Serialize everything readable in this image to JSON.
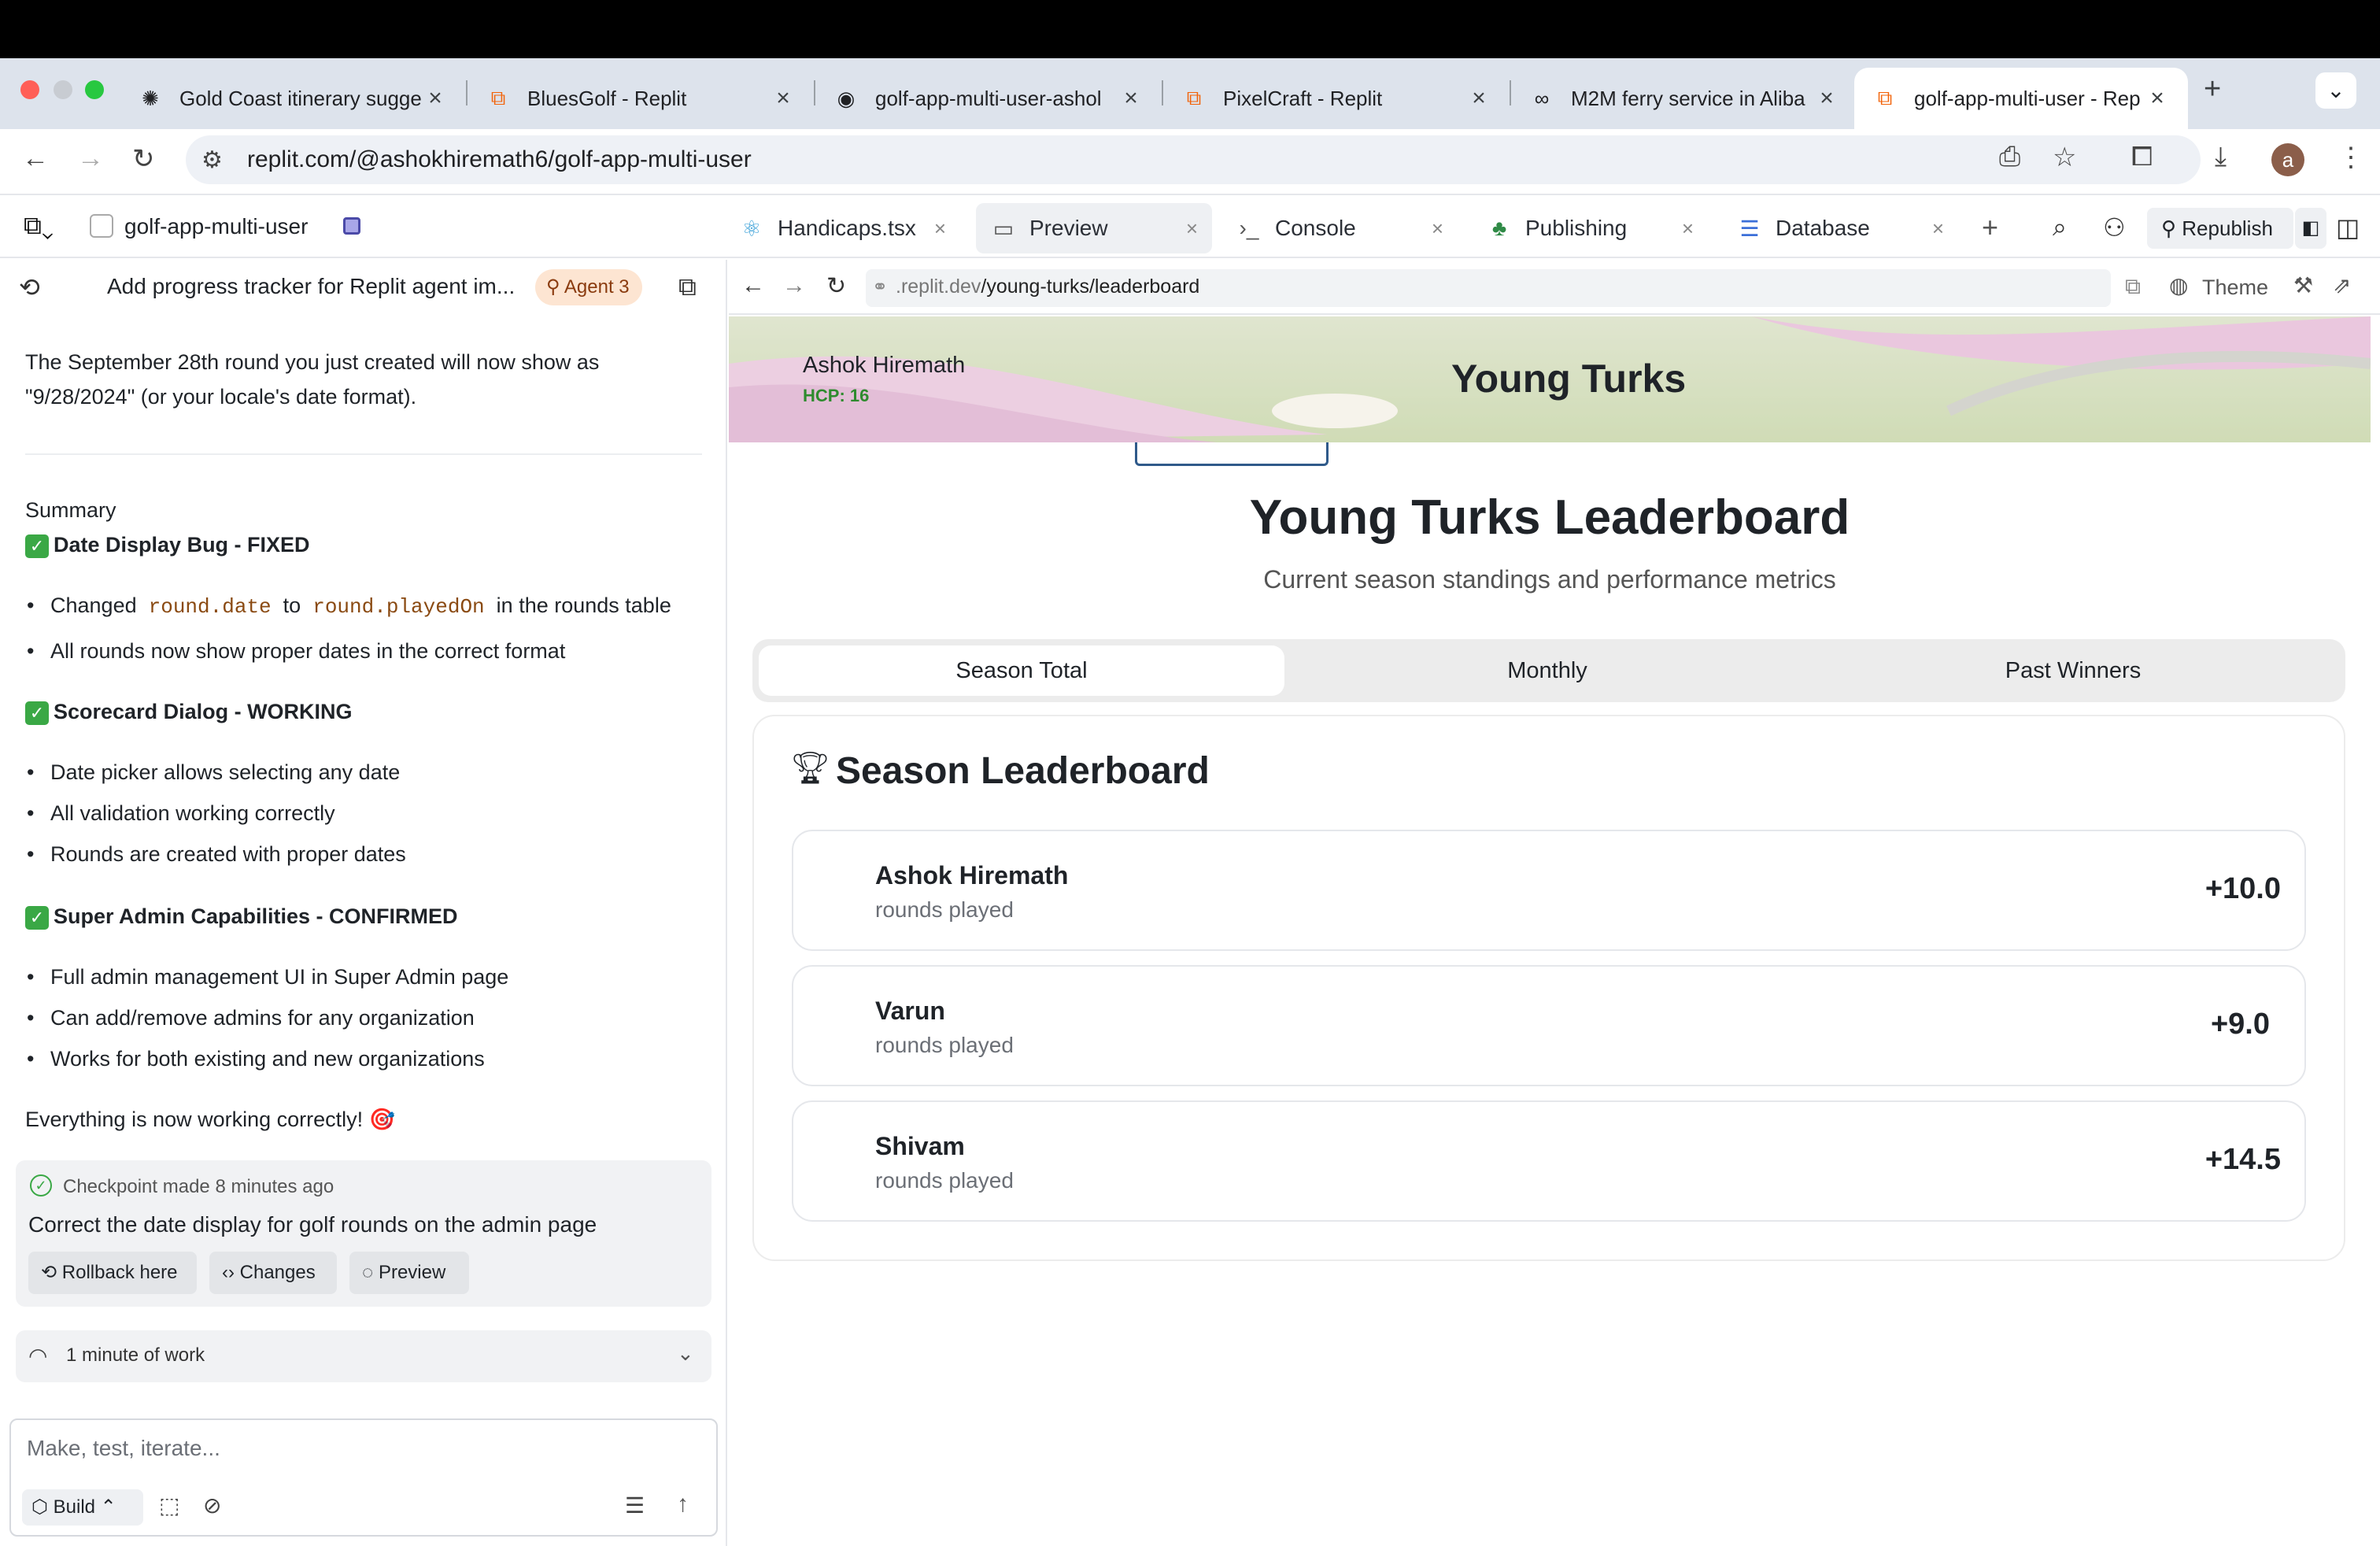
{
  "browser": {
    "tabs": [
      {
        "title": "Gold Coast itinerary sugge",
        "icon": "openai-icon"
      },
      {
        "title": "BluesGolf - Replit",
        "icon": "replit-icon"
      },
      {
        "title": "golf-app-multi-user-ashol",
        "icon": "github-icon"
      },
      {
        "title": "PixelCraft - Replit",
        "icon": "replit-icon"
      },
      {
        "title": "M2M ferry service in Aliba",
        "icon": "ferry-icon"
      },
      {
        "title": "golf-app-multi-user - Rep",
        "icon": "replit-icon",
        "active": true
      }
    ],
    "url": "replit.com/@ashokhiremath6/golf-app-multi-user",
    "profile_initial": "a"
  },
  "replit": {
    "project_name": "golf-app-multi-user",
    "tabs": [
      {
        "label": "Handicaps.tsx",
        "icon": "react-icon"
      },
      {
        "label": "Preview",
        "icon": "monitor-icon",
        "active": true
      },
      {
        "label": "Console",
        "icon": "terminal-icon"
      },
      {
        "label": "Publishing",
        "icon": "publish-icon"
      },
      {
        "label": "Database",
        "icon": "database-icon"
      }
    ],
    "republish_label": "Republish"
  },
  "agent": {
    "task_title": "Add progress tracker for Replit agent im...",
    "agent_badge": "Agent 3",
    "intro_line1": "The September 28th round you just created will now show as",
    "intro_line2": "\"9/28/2024\" (or your locale's date format).",
    "summary_label": "Summary",
    "sections": [
      {
        "heading": "Date Display Bug - FIXED"
      },
      {
        "heading": "Scorecard Dialog - WORKING"
      },
      {
        "heading": "Super Admin Capabilities - CONFIRMED"
      }
    ],
    "s1_b1_pre": "Changed",
    "s1_b1_code1": "round.date",
    "s1_b1_mid": "to",
    "s1_b1_code2": "round.playedOn",
    "s1_b1_post": "in the rounds table",
    "s1_b2": "All rounds now show proper dates in the correct format",
    "s2_b1": "Date picker allows selecting any date",
    "s2_b2": "All validation working correctly",
    "s2_b3": "Rounds are created with proper dates",
    "s3_b1": "Full admin management UI in Super Admin page",
    "s3_b2": "Can add/remove admins for any organization",
    "s3_b3": "Works for both existing and new organizations",
    "closing": "Everything is now working correctly! 🎯",
    "checkpoint": {
      "label": "Checkpoint made",
      "time": "8 minutes ago",
      "message": "Correct the date display for golf rounds on the admin page",
      "rollback": "Rollback here",
      "changes": "Changes",
      "preview": "Preview"
    },
    "work_summary": "1 minute of work",
    "input_placeholder": "Make, test, iterate...",
    "build_label": "Build"
  },
  "preview": {
    "url_prefix": ".replit.dev",
    "url_path": "/young-turks/leaderboard",
    "theme_label": "Theme",
    "user_name": "Ashok Hiremath",
    "handicap": "HCP: 16",
    "banner_title": "Young Turks",
    "page_title": "Young Turks Leaderboard",
    "page_subtitle": "Current season standings and performance metrics",
    "tabs": [
      "Season Total",
      "Monthly",
      "Past Winners"
    ],
    "board_title": "Season Leaderboard",
    "entries": [
      {
        "name": "Ashok Hiremath",
        "sub": "rounds played",
        "score": "+10.0"
      },
      {
        "name": "Varun",
        "sub": "rounds played",
        "score": "+9.0"
      },
      {
        "name": "Shivam",
        "sub": "rounds played",
        "score": "+14.5"
      }
    ]
  }
}
